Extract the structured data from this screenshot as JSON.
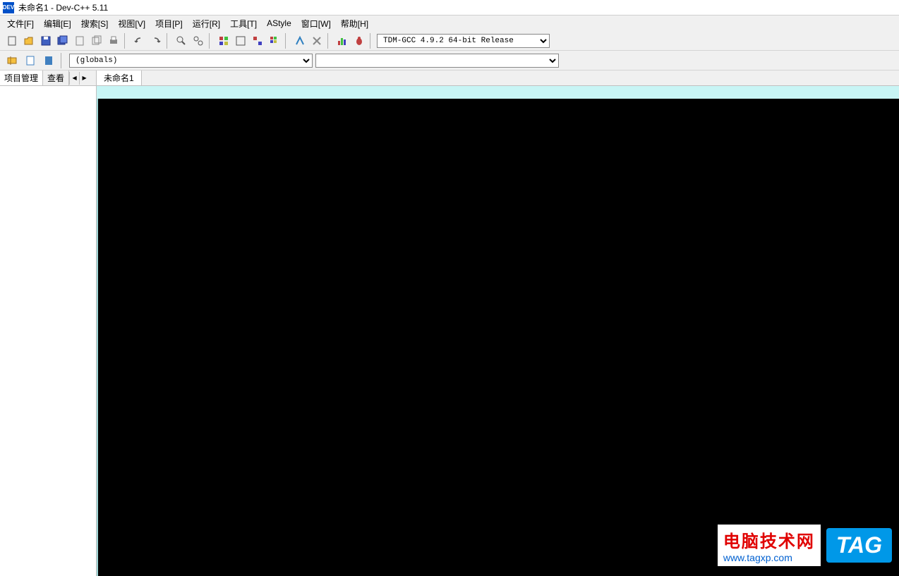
{
  "title": "未命名1 - Dev-C++ 5.11",
  "menu": {
    "file": "文件[F]",
    "edit": "编辑[E]",
    "search": "搜索[S]",
    "view": "视图[V]",
    "project": "项目[P]",
    "run": "运行[R]",
    "tools": "工具[T]",
    "astyle": "AStyle",
    "window": "窗口[W]",
    "help": "帮助[H]"
  },
  "compiler": "TDM-GCC 4.9.2 64-bit Release",
  "globals": "(globals)",
  "symbols": "",
  "sidebar": {
    "tab1": "项目管理",
    "tab2": "查看"
  },
  "editor": {
    "tab1": "未命名1"
  },
  "watermark": {
    "line1": "电脑技术网",
    "line2": "www.tagxp.com",
    "tag": "TAG"
  }
}
